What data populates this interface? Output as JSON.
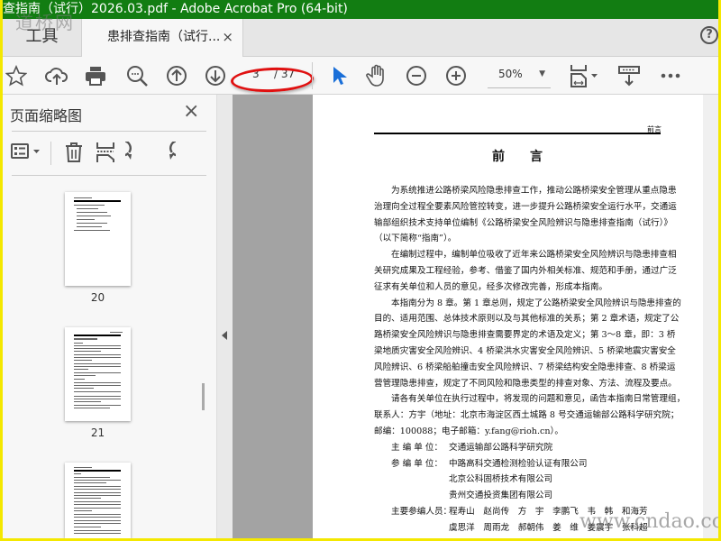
{
  "window": {
    "title": "查指南（试行）2026.03.pdf - Adobe Acrobat Pro (64-bit)"
  },
  "watermarks": {
    "top_left": "道桥网",
    "bottom_right": "www.cndao.com"
  },
  "tabs": {
    "tools": "工具",
    "document": "患排查指南（试行...",
    "close": "×",
    "help": "?"
  },
  "toolbar": {
    "page_current": "3",
    "page_total": "/ 37",
    "zoom": "50%"
  },
  "colors": {
    "titlebar": "#127d12",
    "select_tool": "#1a6fd8",
    "annotation_oval": "#e01010",
    "frame": "#f4e800"
  },
  "sidebar": {
    "title": "页面缩略图",
    "close": "×",
    "thumbnails": [
      {
        "label": "20"
      },
      {
        "label": "21"
      },
      {
        "label": ""
      }
    ]
  },
  "document": {
    "running_header": "前言",
    "title": "前言",
    "paragraphs": [
      [
        "为系统推进公路桥梁风险隐患排查工作，推动公路桥梁安全管理从重点隐患",
        "治理向全过程全要素风险管控转变，进一步提升公路桥梁安全运行水平，交通运",
        "输部组织技术支持单位编制《公路桥梁安全风险辨识与隐患排查指南（试行）》",
        "（以下简称“指南”）。"
      ],
      [
        "在编制过程中，编制单位吸收了近年来公路桥梁安全风险辨识与隐患排查相",
        "关研究成果及工程经验，参考、借鉴了国内外相关标准、规范和手册，通过广泛",
        "征求有关单位和人员的意见，经多次修改完善，形成本指南。"
      ],
      [
        "本指南分为 8 章。第 1 章总则，规定了公路桥梁安全风险辨识与隐患排查的",
        "目的、适用范围、总体技术原则以及与其他标准的关系；第 2 章术语，规定了公",
        "路桥梁安全风险辨识与隐患排查需要界定的术语及定义；第 3～8 章，即：3 桥",
        "梁地质灾害安全风险辨识、4 桥梁洪水灾害安全风险辨识、5 桥梁地震灾害安全",
        "风险辨识、6 桥梁船舶撞击安全风险辨识、7 桥梁结构安全隐患排查、8 桥梁运",
        "营管理隐患排查，规定了不同风险和隐患类型的排查对象、方法、流程及要点。"
      ],
      [
        "请各有关单位在执行过程中，将发现的问题和意见，函告本指南日常管理组，",
        "联系人：方宇（地址：北京市海淀区西土城路 8 号交通运输部公路科学研究院；",
        "邮编：100088；电子邮箱：y.fang@rioh.cn）。"
      ]
    ],
    "organizations": [
      {
        "label": "主 编 单 位：",
        "names": [
          "交通运输部公路科学研究院"
        ]
      },
      {
        "label": "参 编 单 位：",
        "names": [
          "中路高科交通检测检验认证有限公司",
          "北京公科固桥技术有限公司",
          "贵州交通投资集团有限公司"
        ]
      },
      {
        "label": "主要参编人员：",
        "names": [
          "程寿山　赵尚传　方　宇　李鹏飞　韦　韩　和海芳",
          "虞思洋　周雨龙　郝朝伟　姜　维　姜震宇　张科超"
        ]
      }
    ]
  }
}
